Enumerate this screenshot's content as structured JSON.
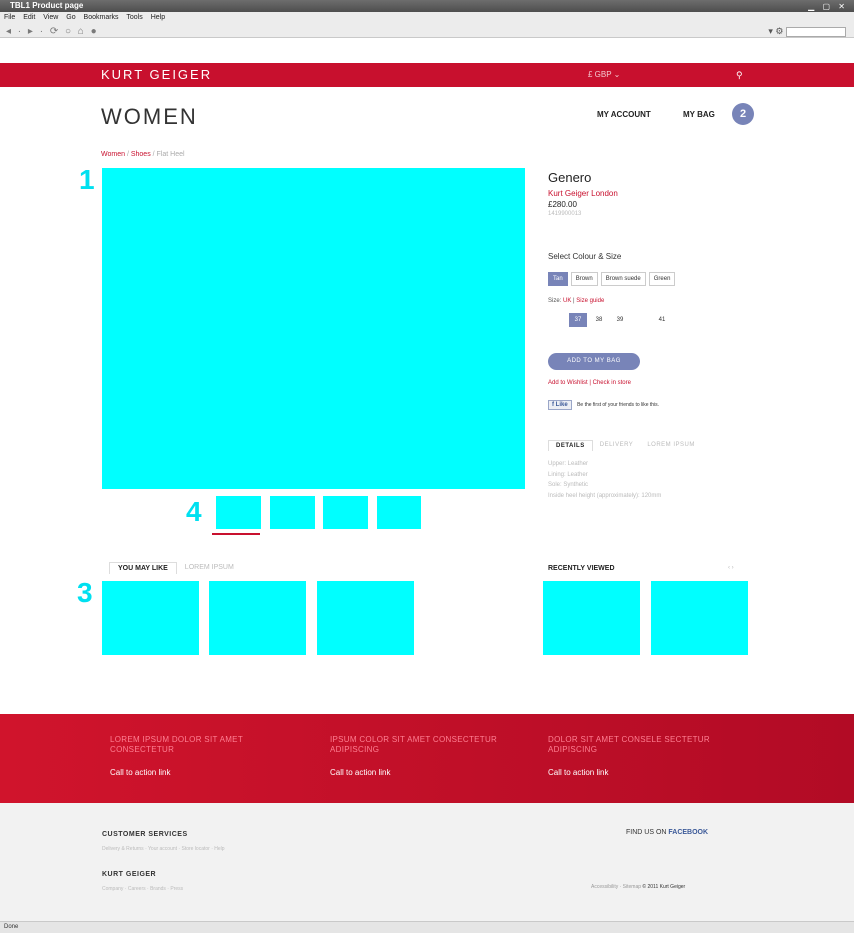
{
  "browser": {
    "title": "TBL1 Product page",
    "window_controls": "▁ ▢ ✕",
    "menus": [
      "File",
      "Edit",
      "View",
      "Go",
      "Bookmarks",
      "Tools",
      "Help"
    ],
    "nav_glyphs": "◂ · ▸ · ⟳ ○ ⌂ ●",
    "status": "Done"
  },
  "header": {
    "logo": "KURT GEIGER",
    "currency": "£ GBP ⌄",
    "search_icon": "search-icon"
  },
  "page": {
    "title": "WOMEN",
    "my_account": "MY ACCOUNT",
    "my_bag": "MY BAG",
    "bag_count": "2",
    "breadcrumb": {
      "women": "Women",
      "shoes": "Shoes",
      "current": "Flat Heel"
    }
  },
  "markers": {
    "main_image": "1",
    "thumbs": "4",
    "recommendations": "3"
  },
  "product": {
    "name": "Genero",
    "brand": "Kurt Geiger London",
    "price": "£280.00",
    "code": "1419900013",
    "select_title": "Select Colour & Size",
    "colours": [
      "Tan",
      "Brown",
      "Brown suede",
      "Green"
    ],
    "size_label": "Size:",
    "size_unit": "UK",
    "size_guide": "Size guide",
    "sizes": [
      "",
      "37",
      "38",
      "39",
      "",
      "41"
    ],
    "add_to_bag": "ADD TO MY BAG",
    "add_wishlist": "Add to Wishlist",
    "check_store": "Check in store",
    "like_button": "Like",
    "like_text": "Be the first of your friends to like this.",
    "tabs": [
      "DETAILS",
      "DELIVERY",
      "LOREM IPSUM"
    ],
    "details": [
      "Upper: Leather",
      "Lining: Leather",
      "Sole: Synthetic",
      "Inside heel height (approximately): 120mm"
    ]
  },
  "recommendations": {
    "tabs": [
      "YOU MAY LIKE",
      "LOREM IPSUM"
    ],
    "recently_viewed": "RECENTLY VIEWED",
    "arrows": "‹ ›"
  },
  "promos": [
    {
      "text": "LOREM IPSUM DOLOR SIT AMET CONSECTETUR",
      "cta": "Call to action link"
    },
    {
      "text": "IPSUM COLOR SIT AMET CONSECTETUR ADIPISCING",
      "cta": "Call to action link"
    },
    {
      "text": "DOLOR SIT AMET CONSELE SECTETUR ADIPISCING",
      "cta": "Call to action link"
    }
  ],
  "footer": {
    "customer_services": "CUSTOMER SERVICES",
    "customer_links": "Delivery & Returns · Your account · Store locator · Help",
    "brand_heading": "KURT GEIGER",
    "brand_links": "Company · Careers · Brands · Press",
    "find_us": "FIND US ON",
    "facebook": "FACEBOOK",
    "legal_links": "Accessibility · Sitemap",
    "copyright": "© 2011 Kurt Geiger"
  },
  "colors": {
    "brand_red": "#c8102e",
    "accent_blue": "#7884b8",
    "placeholder": "#00ffff"
  }
}
